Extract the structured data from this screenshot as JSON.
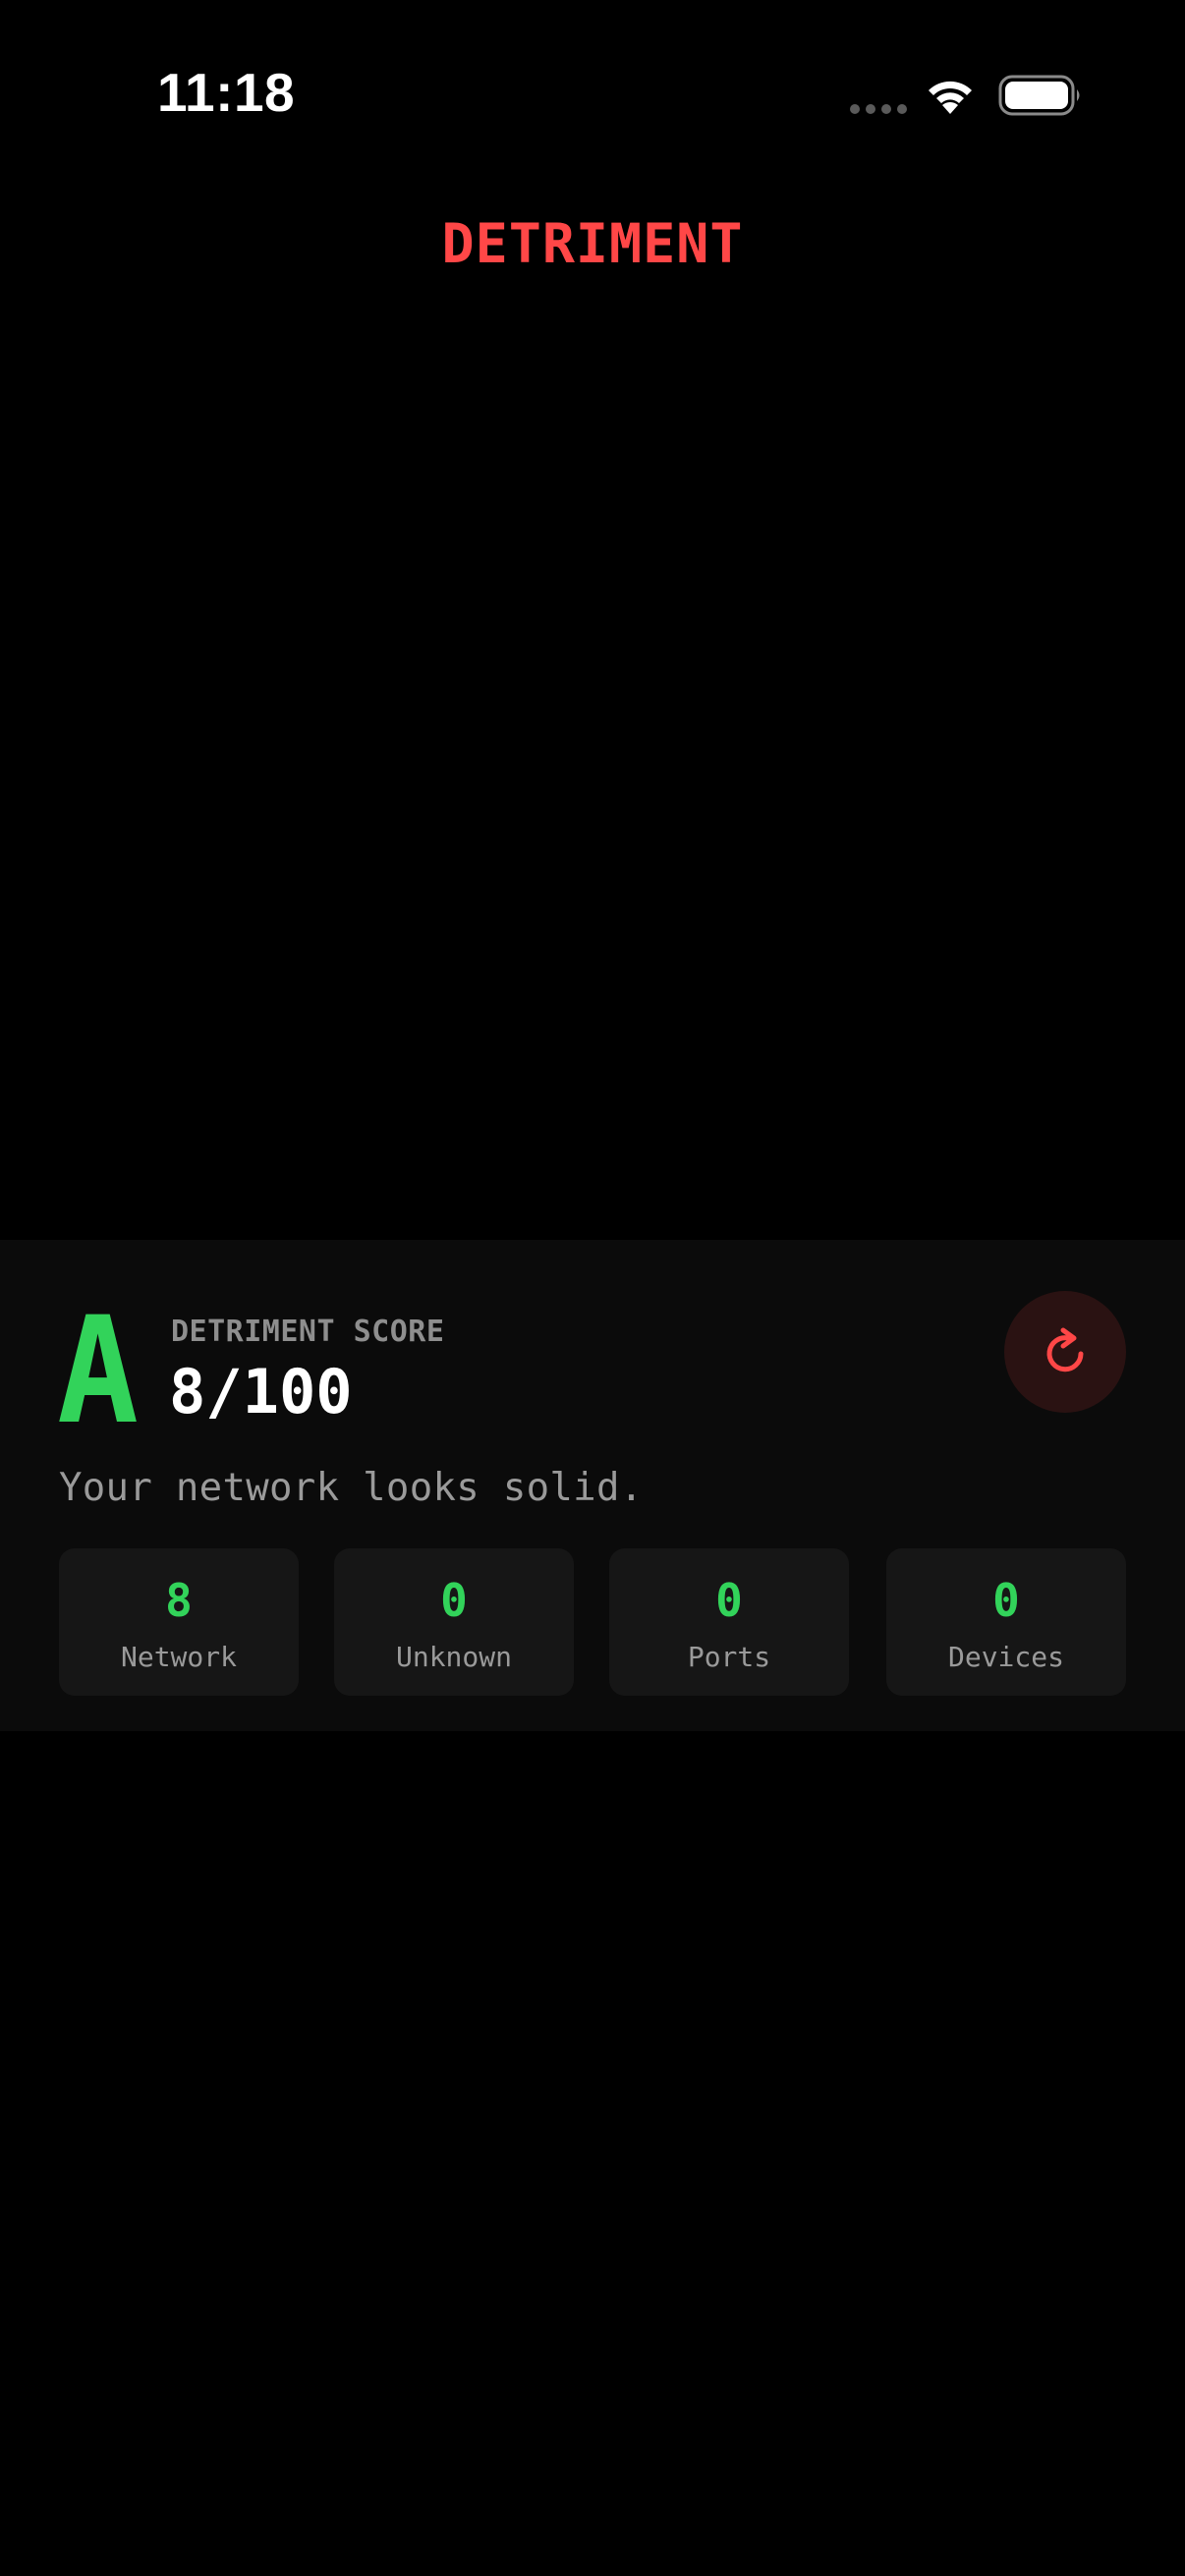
{
  "status_bar": {
    "time": "11:18",
    "icons": [
      "signal-dots-icon",
      "wifi-icon",
      "battery-icon"
    ]
  },
  "header": {
    "title": "DETRIMENT"
  },
  "score": {
    "grade": "A",
    "label": "DETRIMENT SCORE",
    "value": "8/100",
    "summary": "Your network looks solid.",
    "refresh_icon": "refresh-icon"
  },
  "stats": [
    {
      "value": "8",
      "label": "Network"
    },
    {
      "value": "0",
      "label": "Unknown"
    },
    {
      "value": "0",
      "label": "Ports"
    },
    {
      "value": "0",
      "label": "Devices"
    }
  ],
  "colors": {
    "accent_red": "#ff4747",
    "accent_green": "#32d35a",
    "background": "#000000",
    "panel": "#0b0b0b",
    "card": "#161616",
    "muted_text": "#9a9a9a"
  }
}
